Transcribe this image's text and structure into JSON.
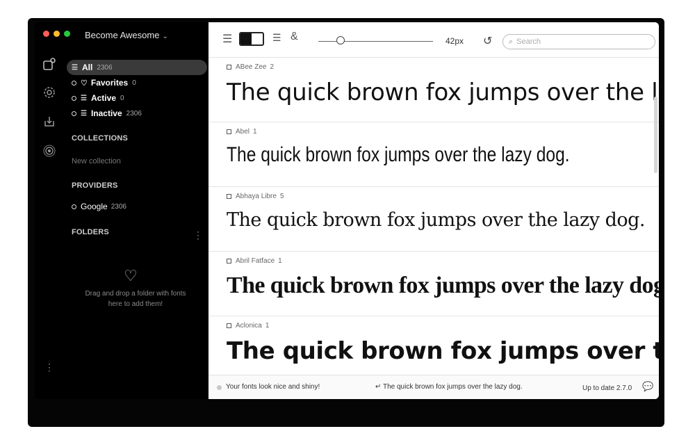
{
  "window": {
    "workspace_title": "Become Awesome",
    "traffic_colors": [
      "#ff5f57",
      "#febc2e",
      "#28c840"
    ]
  },
  "sidebar": {
    "rail_icons": [
      "fonts-icon",
      "settings-gear-icon",
      "import-icon",
      "broadcast-icon"
    ],
    "filters": [
      {
        "label": "All",
        "count": "2306",
        "icon": "list-icon"
      },
      {
        "label": "Favorites",
        "count": "0",
        "icon": "heart-icon"
      },
      {
        "label": "Active",
        "count": "0",
        "icon": "list-icon"
      },
      {
        "label": "Inactive",
        "count": "2306",
        "icon": "list-icon"
      }
    ],
    "collections_heading": "COLLECTIONS",
    "new_collection_label": "New collection",
    "providers_heading": "PROVIDERS",
    "provider": {
      "label": "Google",
      "count": "2306"
    },
    "folders_heading": "FOLDERS",
    "drop_hint": "Drag and drop a folder with fonts here to add them!"
  },
  "toolbar": {
    "font_size": "42px",
    "search_placeholder": "Search"
  },
  "fonts": [
    {
      "name": "ABee Zee",
      "count": "2",
      "sample": "The quick brown fox jumps over the lazy dog."
    },
    {
      "name": "Abel",
      "count": "1",
      "sample": "The quick brown fox jumps over the lazy dog."
    },
    {
      "name": "Abhaya Libre",
      "count": "5",
      "sample": "The quick brown fox jumps over the lazy dog."
    },
    {
      "name": "Abril Fatface",
      "count": "1",
      "sample": "The quick brown fox jumps over the lazy dog."
    },
    {
      "name": "Aclonica",
      "count": "1",
      "sample": "The quick brown fox jumps over the lazy dog."
    }
  ],
  "status": {
    "message": "Your fonts look nice and shiny!",
    "sample_preview": "The quick brown fox jumps over the lazy dog.",
    "version": "Up to date 2.7.0"
  }
}
